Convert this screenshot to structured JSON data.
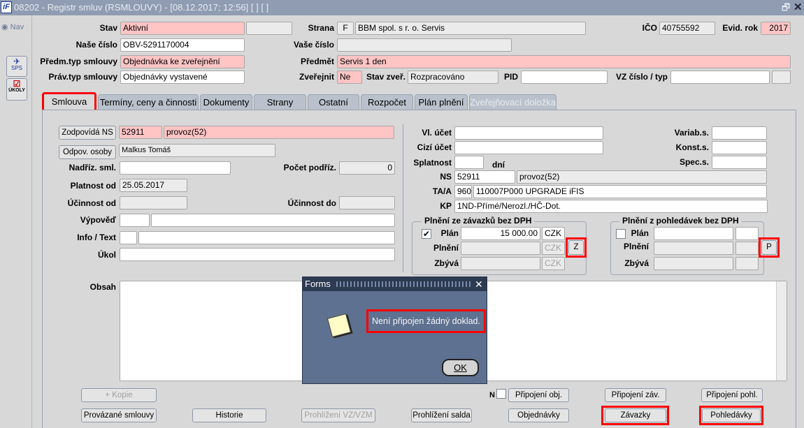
{
  "window": {
    "title": "08202 - Registr smluv (RSMLOUVY) - [08.12.2017; 12:56]  [ ]  [ ]",
    "logo": "iF"
  },
  "left": {
    "nav": "Nav",
    "sps": "SPS",
    "ukoly": "ÚKOLY"
  },
  "header": {
    "stav_label": "Stav",
    "stav": "Aktivní",
    "strana_label": "Strana",
    "strana_code": "F",
    "strana": "BBM spol. s r. o. Servis",
    "ico_label": "IČO",
    "ico": "40755592",
    "evid_rok_label": "Evid. rok",
    "evid_rok": "2017",
    "nase_cislo_label": "Naše číslo",
    "nase_cislo": "OBV-5291170004",
    "vase_cislo_label": "Vaše číslo",
    "predm_typ_label": "Předm.typ smlouvy",
    "predm_typ": "Objednávka ke zveřejnění",
    "predmet_label": "Předmět",
    "predmet": "Servis 1 den",
    "prav_typ_label": "Práv.typ smlouvy",
    "prav_typ": "Objednávky vystavené",
    "zverejnit_label": "Zveřejnit",
    "zverejnit": "Ne",
    "stav_zver_label": "Stav zveř.",
    "stav_zver": "Rozpracováno",
    "pid_label": "PID",
    "vz_label": "VZ číslo / typ"
  },
  "tabs": [
    "Smlouva",
    "Termíny, ceny a činnosti",
    "Dokumenty",
    "Strany",
    "Ostatní",
    "Rozpočet",
    "Plán plnění",
    "Zveřejňovací doložka"
  ],
  "form": {
    "zodpovida_btn": "Zodpovídá NS",
    "zodp_ns": "52911",
    "zodp_ns_name": "provoz(52)",
    "odpov_osoby_btn": "Odpov. osoby",
    "odpov_osoba": "Malkus Tomáš",
    "nadriz_label": "Nadříz. sml.",
    "pocet_podriz_label": "Počet podříz.",
    "pocet_podriz": "0",
    "platnost_od_label": "Platnost od",
    "platnost_od": "25.05.2017",
    "ucinnost_od_label": "Účinnost od",
    "ucinnost_do_label": "Účinnost do",
    "vypoved_label": "Výpověď",
    "info_label": "Info / Text",
    "ukol_label": "Úkol",
    "obsah_label": "Obsah",
    "vl_ucet_label": "Vl. účet",
    "cizi_ucet_label": "Cizí účet",
    "splatnost_label": "Splatnost",
    "dni": "dní",
    "variab_label": "Variab.s.",
    "konst_label": "Konst.s.",
    "spec_label": "Spec.s.",
    "ns_label": "NS",
    "ns": "52911",
    "ns_name": "provoz(52)",
    "ta_label": "TA/A",
    "ta_code": "960",
    "ta": "110007P000 UPGRADE iFIS",
    "kp_label": "KP",
    "kp": "1ND-Přímé/Nerozl./HČ-Dot."
  },
  "zavazky": {
    "title": "Plnění ze závazků bez DPH",
    "plan_checked": true,
    "plan_label": "Plán",
    "plan": "15 000.00",
    "currency": "CZK",
    "plneni_label": "Plnění",
    "zbyva_label": "Zbývá",
    "btn": "Z"
  },
  "pohledavky": {
    "title": "Plnění z pohledávek bez DPH",
    "plan_checked": false,
    "plan_label": "Plán",
    "plneni_label": "Plnění",
    "zbyva_label": "Zbývá",
    "btn": "P"
  },
  "buttons": {
    "kopie": "+ Kopie",
    "n_label": "N",
    "pripojeni_obj": "Připojení obj.",
    "pripojeni_zav": "Připojení záv.",
    "pripojeni_pohl": "Připojení pohl.",
    "provazane": "Provázané smlouvy",
    "historie": "Historie",
    "prohlizeni_vz": "Prohlížení VZ/VZM",
    "prohlizeni_salda": "Prohlížení salda",
    "objednavky": "Objednávky",
    "zavazky": "Závazky",
    "pohledavky": "Pohledávky"
  },
  "dialog": {
    "title": "Forms",
    "message": "Není připojen žádný doklad.",
    "ok": "OK"
  }
}
